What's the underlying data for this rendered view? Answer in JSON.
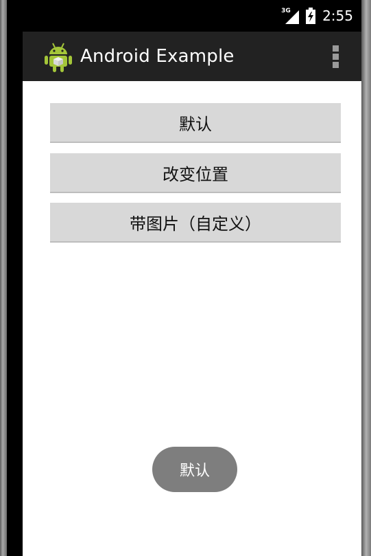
{
  "status_bar": {
    "network_type": "3G",
    "time": "2:55",
    "icons": [
      "signal-icon",
      "battery-icon"
    ]
  },
  "action_bar": {
    "title": "Android Example",
    "icon": "android-icon",
    "menu_icon": "overflow-menu-icon"
  },
  "buttons": {
    "default_label": "默认",
    "change_position_label": "改变位置",
    "custom_image_label": "带图片（自定义）"
  },
  "toast": {
    "text": "默认"
  },
  "colors": {
    "action_bar": "#222222",
    "button": "#d8d8d8",
    "toast": "#7e7e7e"
  }
}
